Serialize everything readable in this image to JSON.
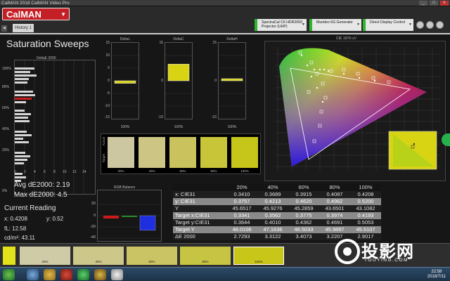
{
  "window": {
    "title": "CalMAN 2018 CalMAN Video Pro",
    "controls": [
      "_",
      "□",
      "x"
    ]
  },
  "header": {
    "logo": "CalMAN",
    "history_tab": "History 1",
    "devices": [
      {
        "line1": "SpectraCal C6 HDR2000",
        "line2": "Projector (UHP)"
      },
      {
        "line1": "Murideo 6G Generator",
        "line2": ""
      },
      {
        "line1": "Direct Display Control",
        "line2": ""
      }
    ]
  },
  "page": {
    "title": "Saturation Sweeps"
  },
  "de_chart": {
    "title": "DeltaE 2000",
    "y_ticks": [
      "100%",
      "80%",
      "60%",
      "40%",
      "20%",
      "0%"
    ],
    "x_ticks": [
      "0",
      "2",
      "4",
      "6",
      "8",
      "10",
      "12",
      "14"
    ]
  },
  "delta_charts": [
    {
      "title": "DeltaL",
      "value": -1.0,
      "xlabel": "100%"
    },
    {
      "title": "DeltaC",
      "value": 6.6,
      "xlabel": "100%"
    },
    {
      "title": "DeltaH",
      "value": 0.8,
      "xlabel": "100%"
    }
  ],
  "delta_axis": [
    "15",
    "10",
    "5",
    "0",
    "-5",
    "-10",
    "-15"
  ],
  "swatches": {
    "label_actual": "Actual",
    "label_target": "Target",
    "items": [
      {
        "caption": "20%",
        "color": "#cdc7a1"
      },
      {
        "caption": "40%",
        "color": "#ccc583"
      },
      {
        "caption": "60%",
        "color": "#cac35d"
      },
      {
        "caption": "80%",
        "color": "#c9c539"
      },
      {
        "caption": "100%",
        "color": "#c6c51a"
      }
    ]
  },
  "stats": {
    "avg": "Avg dE2000: 2.19",
    "max": "Max dE2000: 4.5",
    "current_reading_label": "Current Reading",
    "x": "x: 0.4208",
    "y": "y: 0.52",
    "fl": "fL: 12.58",
    "cdm2": "cd/m²: 43.11"
  },
  "rgb_balance": {
    "title": "RGB Balance",
    "axis": [
      "20",
      "0",
      "-20",
      "-40"
    ],
    "red": -5,
    "green": -1,
    "blue": -26
  },
  "table": {
    "headers": [
      "",
      "20%",
      "40%",
      "60%",
      "80%",
      "100%"
    ],
    "rows": [
      {
        "label": "x: CIE31",
        "values": [
          "0.3410",
          "0.3689",
          "0.3915",
          "0.4087",
          "0.4208"
        ],
        "style": "dark"
      },
      {
        "label": "y: CIE31",
        "values": [
          "0.3757",
          "0.4213",
          "0.4620",
          "0.4962",
          "0.5200"
        ],
        "style": "light"
      },
      {
        "label": "Y",
        "values": [
          "45.6517",
          "45.9276",
          "45.2859",
          "43.6501",
          "43.1082"
        ],
        "style": "dark"
      },
      {
        "label": "Target x:CIE31",
        "values": [
          "0.3341",
          "0.3562",
          "0.3775",
          "0.3974",
          "0.4193"
        ],
        "style": "light"
      },
      {
        "label": "Target y:CIE31",
        "values": [
          "0.3644",
          "0.4010",
          "0.4362",
          "0.4691",
          "0.5053"
        ],
        "style": "dark"
      },
      {
        "label": "Target Y",
        "values": [
          "48.0106",
          "47.1636",
          "46.5033",
          "45.9887",
          "45.5107"
        ],
        "style": "light"
      },
      {
        "label": "ΔE 2000",
        "values": [
          "2.7293",
          "3.3122",
          "3.4073",
          "3.2207",
          "2.9017"
        ],
        "style": "dark"
      }
    ]
  },
  "cie": {
    "title": "CIE 1976 u'v'",
    "y_ticks": [
      "0.55",
      "0.5",
      "0.45",
      "0.4",
      "0.35",
      "0.3",
      "0.25",
      "0.2",
      "0.15",
      "0.1",
      "0.05"
    ],
    "x_ticks": [
      "0.05",
      "0.1",
      "0.15",
      "0.2",
      "0.25",
      "0.3",
      "0.35",
      "0.4",
      "0.45",
      "0.5",
      "0.55",
      "0.6"
    ]
  },
  "bottom_strip": {
    "items": [
      {
        "caption": "",
        "color": "#e2e21c"
      },
      {
        "caption": "20%",
        "color": "#cfcba6"
      },
      {
        "caption": "40%",
        "color": "#cdc78a"
      },
      {
        "caption": "60%",
        "color": "#cac465"
      },
      {
        "caption": "80%",
        "color": "#c8c443"
      },
      {
        "caption": "100%",
        "color": "#c9c61a"
      }
    ]
  },
  "watermark": {
    "text": "投影网",
    "url": "TOUYING.COM"
  },
  "taskbar": {
    "time": "22:58",
    "date": "2018/7/11"
  },
  "colors": {
    "brand": "#c41f26",
    "yellow": "#d8d414",
    "red_bar": "#cc1b1b",
    "green_bar": "#2a8a2a",
    "blue_bar": "#1f2fe0"
  }
}
